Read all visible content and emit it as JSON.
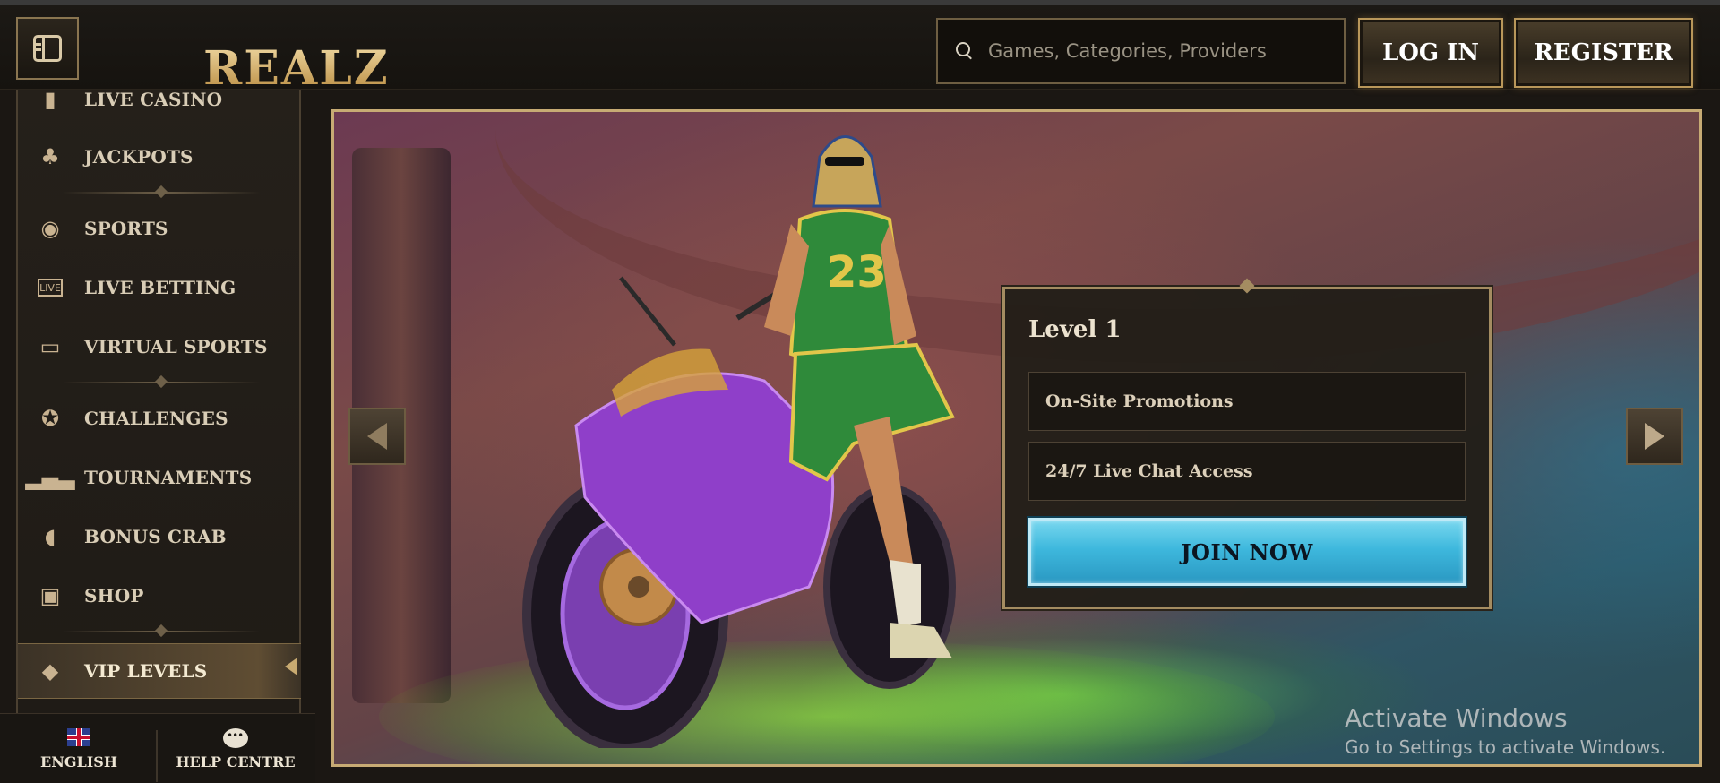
{
  "header": {
    "logo_text": "REALZ",
    "search_placeholder": "Games, Categories, Providers",
    "login_label": "LOG IN",
    "register_label": "REGISTER"
  },
  "sidebar": {
    "items": [
      {
        "label": "LIVE CASINO",
        "icon": "card-icon"
      },
      {
        "label": "JACKPOTS",
        "icon": "clover-icon"
      },
      {
        "label": "SPORTS",
        "icon": "ball-icon"
      },
      {
        "label": "LIVE BETTING",
        "icon": "live-icon"
      },
      {
        "label": "VIRTUAL SPORTS",
        "icon": "monitor-icon"
      },
      {
        "label": "CHALLENGES",
        "icon": "medal-icon"
      },
      {
        "label": "TOURNAMENTS",
        "icon": "podium-icon"
      },
      {
        "label": "BONUS CRAB",
        "icon": "crab-icon"
      },
      {
        "label": "SHOP",
        "icon": "bag-icon"
      },
      {
        "label": "VIP LEVELS",
        "icon": "diamond-icon"
      }
    ],
    "bottom": {
      "language_label": "ENGLISH",
      "help_label": "HELP CENTRE"
    }
  },
  "banner": {
    "level_title": "Level 1",
    "perks": [
      "On-Site Promotions",
      "24/7 Live Chat Access"
    ],
    "join_label": "JOIN NOW",
    "jersey_number": "23"
  },
  "watermark": {
    "line1": "Activate Windows",
    "line2": "Go to Settings to activate Windows."
  }
}
